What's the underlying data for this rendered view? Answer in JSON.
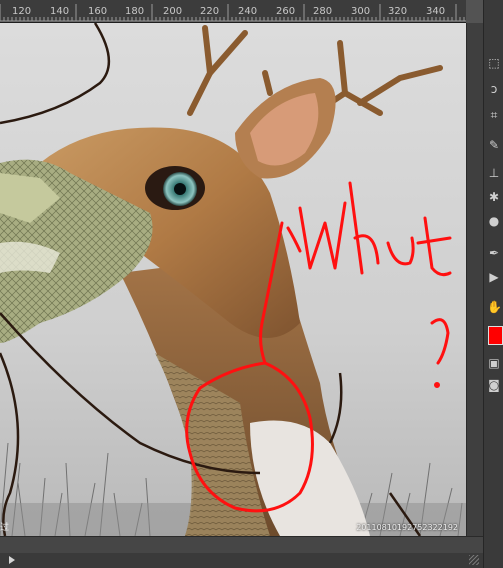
{
  "ruler": {
    "labels": [
      "120",
      "140",
      "160",
      "180",
      "200",
      "220",
      "240",
      "260",
      "280",
      "300",
      "320",
      "340"
    ]
  },
  "canvas": {
    "annotation_text": "What",
    "annotation_question": "?",
    "watermark": "20110810192752322192",
    "corner_text": "过"
  },
  "colors": {
    "foreground": "#ff0000",
    "annotation": "#ff1010"
  },
  "toolbar": {
    "icons": [
      "marquee-icon",
      "lasso-icon",
      "crop-icon",
      "healing-brush-icon",
      "clone-stamp-icon",
      "blur-icon",
      "dodge-icon",
      "pen-icon",
      "path-select-icon",
      "hand-icon",
      "foreground-color-swatch",
      "swap-colors-icon",
      "quick-mask-icon"
    ]
  }
}
